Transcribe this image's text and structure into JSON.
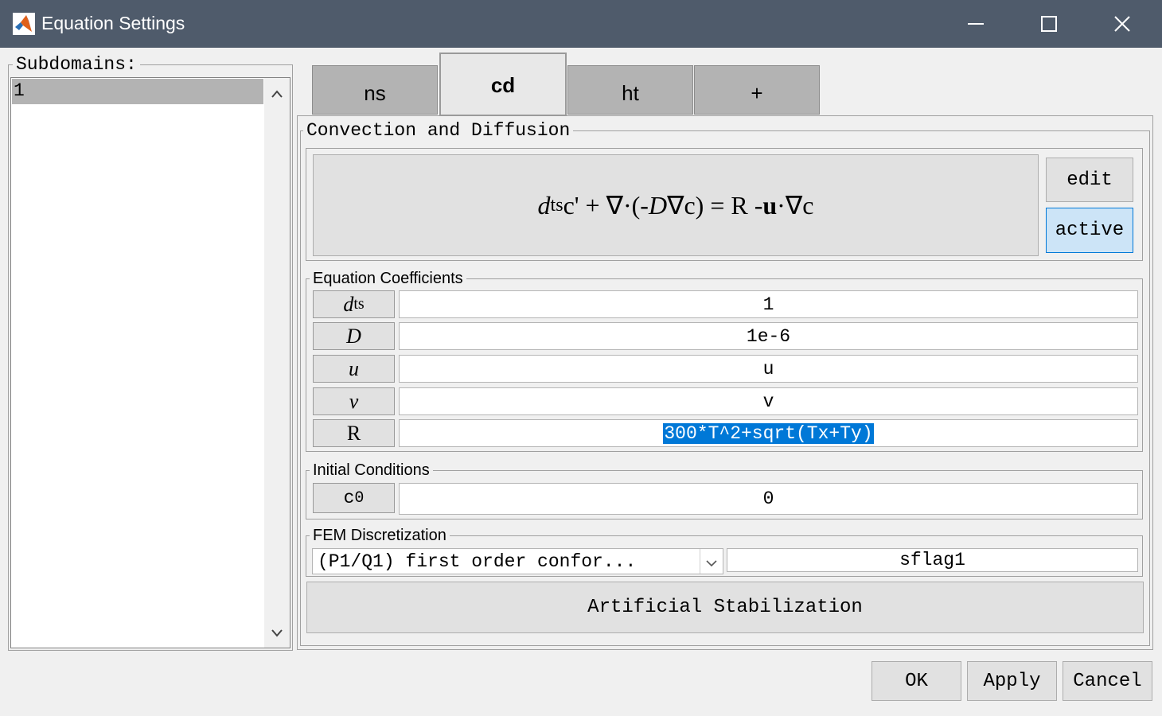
{
  "window": {
    "title": "Equation Settings",
    "app_icon": "matlab-icon",
    "controls": {
      "minimize": "minimize-icon",
      "maximize": "maximize-icon",
      "close": "close-icon"
    }
  },
  "subdomains": {
    "label": "Subdomains:",
    "items": [
      "1"
    ],
    "selected": "1"
  },
  "tabs": [
    {
      "label": "ns",
      "active": false
    },
    {
      "label": "cd",
      "active": true
    },
    {
      "label": "ht",
      "active": false
    },
    {
      "label": "+",
      "active": false
    }
  ],
  "panel": {
    "title": "Convection and Diffusion",
    "equation": {
      "d": "d",
      "ts_sub": "ts",
      "c1": "c' + ∇·(-",
      "D": "D",
      "nabla": "∇",
      "c2": "c) = R - ",
      "u": "u",
      "rest": "·∇",
      "c3": "c"
    },
    "edit_label": "edit",
    "active_label": "active",
    "coefficients_title": "Equation Coefficients",
    "coefficients": [
      {
        "symbol": "d",
        "sub": "ts",
        "value": "1"
      },
      {
        "symbol": "D",
        "sub": "",
        "value": "1e-6"
      },
      {
        "symbol": "u",
        "sub": "",
        "value": "u"
      },
      {
        "symbol": "v",
        "sub": "",
        "value": "v"
      },
      {
        "symbol": "R",
        "sub": "",
        "value": "300*T^2+sqrt(Tx+Ty)"
      }
    ],
    "initial_title": "Initial Conditions",
    "initial": {
      "symbol": "c",
      "sub": "0",
      "value": "0"
    },
    "fem_title": "FEM Discretization",
    "fem_select": "(P1/Q1) first order confor...",
    "fem_flag": "sflag1",
    "stabilization_label": "Artificial Stabilization"
  },
  "buttons": {
    "ok": "OK",
    "apply": "Apply",
    "cancel": "Cancel"
  },
  "colors": {
    "titlebar": "#4f5b6b",
    "selection": "#0078d7",
    "active_button": "#cce4f7"
  }
}
